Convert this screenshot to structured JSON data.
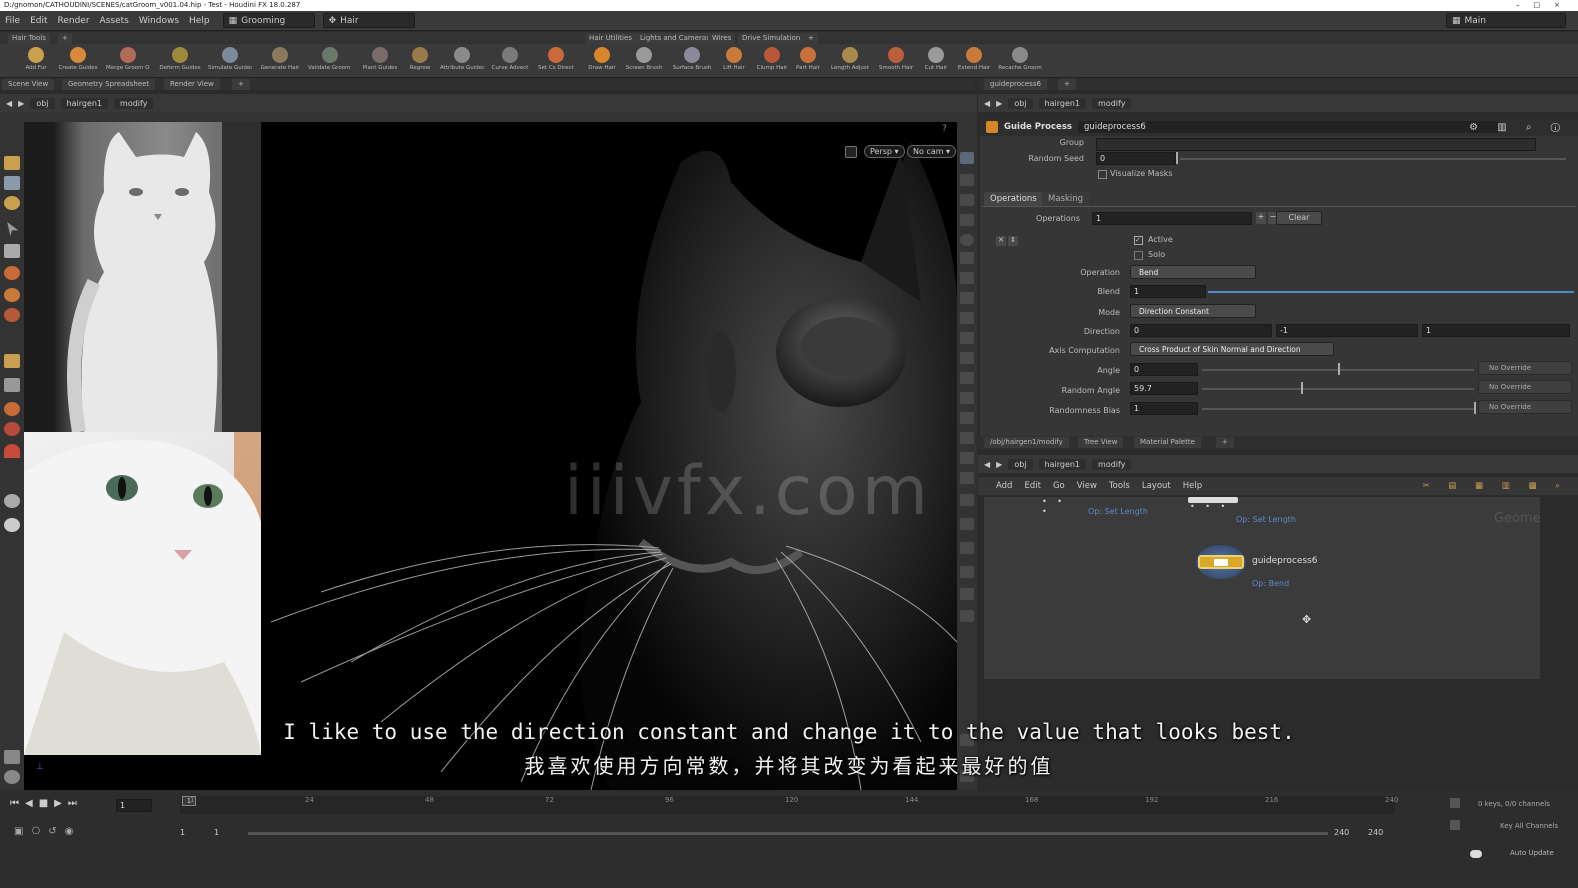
{
  "window": {
    "title": "D:/gnomon/CATHOUDINI/SCENES/catGroom_v001.04.hip - Test - Houdini FX 18.0.287"
  },
  "menu": {
    "items": [
      "File",
      "Edit",
      "Render",
      "Assets",
      "Windows",
      "Help"
    ],
    "desktop": "Grooming",
    "context": "Hair",
    "right_desktop": "Main"
  },
  "shelf": {
    "left_tab": "Hair Tools",
    "right_tabs": [
      "Hair Utilities",
      "Lights and Cameras",
      "Wires",
      "Drive Simulation"
    ],
    "left_tools": [
      "Add Fur",
      "Create Guides",
      "Merge Groom Objects",
      "Deform Guides",
      "Simulate Guides",
      "Generate Hair",
      "Validate Groom Point",
      "Plant Guides",
      "Regrow"
    ],
    "mid_tools": [
      "Attribute Guides",
      "Curve Advect",
      "Set Cs Direct"
    ],
    "right_tools": [
      "Draw Hair",
      "Screen Brush",
      "Surface Brush",
      "Lift Hair",
      "Clump Hair",
      "Part Hair",
      "Length Adjust",
      "Smooth Hair",
      "Cut Hair",
      "Extend Hair",
      "Recache Groom"
    ]
  },
  "left_pane": {
    "tabs": [
      "Scene View",
      "Geometry Spreadsheet",
      "Render View"
    ],
    "path": [
      "obj",
      "hairgen1",
      "modify"
    ],
    "viewport": {
      "persp": "Persp",
      "cam": "No cam"
    }
  },
  "right_pane": {
    "tab": "guideprocess6",
    "path": [
      "obj",
      "hairgen1",
      "modify"
    ],
    "node_type": "Guide Process",
    "node_name": "guideprocess6",
    "params": {
      "group_label": "Group",
      "random_seed_label": "Random Seed",
      "random_seed": "0",
      "visualize_masks": "Visualize Masks",
      "tabs": [
        "Operations",
        "Masking"
      ],
      "operations_label": "Operations",
      "operations": "1",
      "clear_label": "Clear",
      "active_label": "Active",
      "solo_label": "Solo",
      "operation_label": "Operation",
      "operation": "Bend",
      "blend_label": "Blend",
      "blend": "1",
      "mode_label": "Mode",
      "mode": "Direction Constant",
      "direction_label": "Direction",
      "direction": [
        "0",
        "-1",
        "1"
      ],
      "axis_label": "Axis Computation",
      "axis": "Cross Product of Skin Normal and Direction",
      "angle_label": "Angle",
      "angle": "0",
      "random_angle_label": "Random Angle",
      "random_angle": "59.7",
      "randomness_bias_label": "Randomness Bias",
      "randomness_bias": "1",
      "override": "No Override"
    }
  },
  "network_pane": {
    "tabs": [
      "/obj/hairgen1/modify",
      "Tree View",
      "Material Palette"
    ],
    "path": [
      "obj",
      "hairgen1",
      "modify"
    ],
    "menu": [
      "Add",
      "Edit",
      "Go",
      "View",
      "Tools",
      "Layout",
      "Help"
    ],
    "watermark": "Geometry",
    "nodes": [
      {
        "name": "guideprocess6",
        "sub": "Op: Bend"
      },
      {
        "sub": "Op: Set Length"
      },
      {
        "sub": "Op: Set Length"
      }
    ]
  },
  "timeline": {
    "current_frame": "1",
    "start": "1",
    "start2": "1",
    "end": "240",
    "end2": "240",
    "ticks": [
      "1",
      "24",
      "48",
      "72",
      "96",
      "120",
      "144",
      "168",
      "192",
      "216",
      "240"
    ],
    "keys_info": "0 keys, 0/0 channels",
    "key_all": "Key All Channels",
    "auto_update": "Auto Update"
  },
  "subtitles": {
    "en": "I like to use the direction constant and change it to the value that looks best.",
    "zh": "我喜欢使用方向常数，并将其改变为看起来最好的值"
  },
  "overlay": {
    "watermark": "iiivfx.com"
  }
}
